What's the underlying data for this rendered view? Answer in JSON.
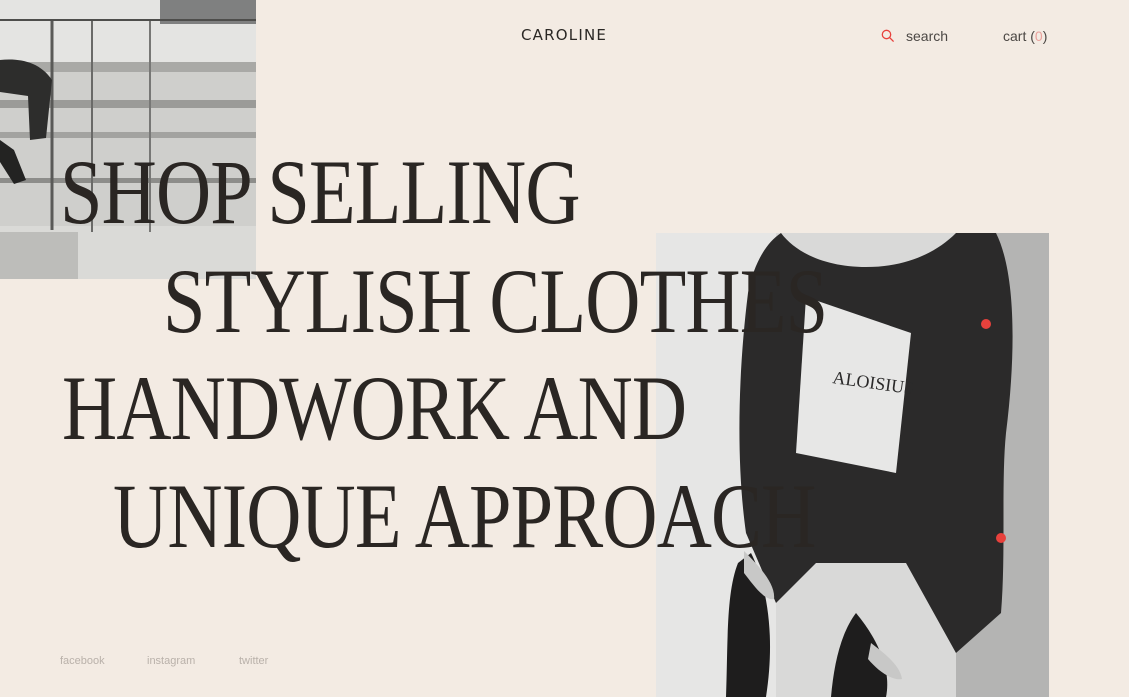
{
  "header": {
    "logo": "CAROLINE",
    "search_label": "search",
    "cart_label": "cart",
    "cart_open": "(",
    "cart_count": "0",
    "cart_close": ")",
    "search_icon": "search-icon"
  },
  "hero": {
    "lines": [
      "SHOP SELLING",
      "STYLISH CLOTHES",
      "HANDWORK AND",
      "UNIQUE APPROACH"
    ],
    "accent_punctuation": "."
  },
  "social": {
    "links": [
      "facebook",
      "instagram",
      "twitter"
    ]
  },
  "colors": {
    "background": "#f3ebe3",
    "text": "#2a2623",
    "accent": "#e8413c",
    "cart_count": "#e9a19c",
    "social_text": "#b9b1aa"
  },
  "images": {
    "top_left": "black-and-white street photo of person on stairs",
    "right": "black-and-white photo of model wearing oversized sweatshirt"
  }
}
